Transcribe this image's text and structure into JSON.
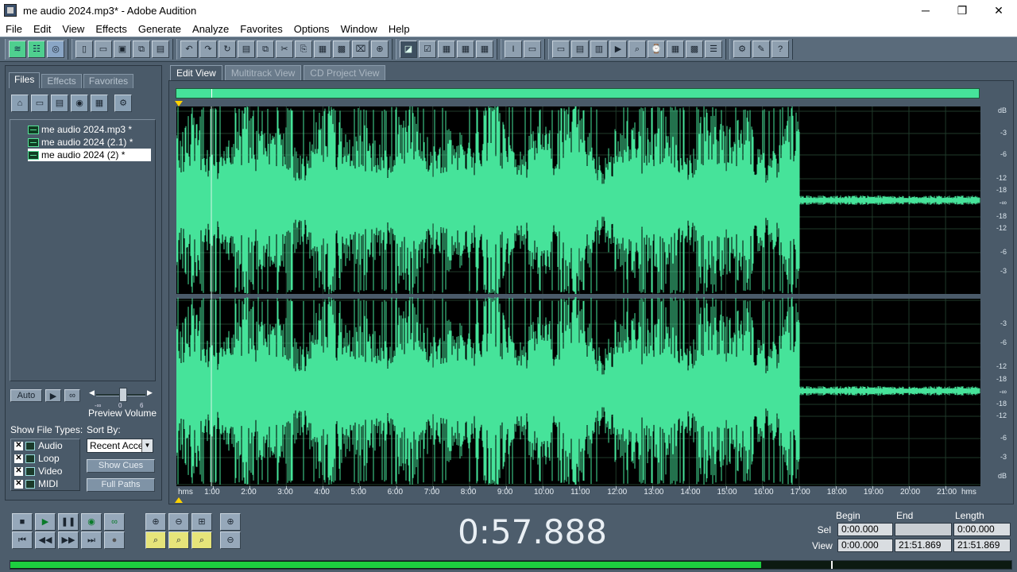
{
  "window": {
    "title": "me audio 2024.mp3* - Adobe Audition",
    "controls": {
      "minimize": "─",
      "maximize": "❐",
      "close": "✕"
    }
  },
  "menu": [
    "File",
    "Edit",
    "View",
    "Effects",
    "Generate",
    "Analyze",
    "Favorites",
    "Options",
    "Window",
    "Help"
  ],
  "left_panel": {
    "tabs": [
      "Files",
      "Effects",
      "Favorites"
    ],
    "active_tab": "Files",
    "files": [
      {
        "name": "me audio 2024.mp3 *",
        "selected": false
      },
      {
        "name": "me audio 2024 (2.1) *",
        "selected": false
      },
      {
        "name": "me audio 2024 (2) *",
        "selected": true
      }
    ],
    "preview": {
      "auto_label": "Auto",
      "play_icon": "▶",
      "loop_icon": "∞",
      "volume_label": "Preview Volume",
      "slider_min": "-∞",
      "slider_mid": "0",
      "slider_max": "6",
      "volume_level": 0.55
    },
    "file_types_label": "Show File Types:",
    "file_types": [
      {
        "label": "Audio",
        "checked": true
      },
      {
        "label": "Loop",
        "checked": true
      },
      {
        "label": "Video",
        "checked": true
      },
      {
        "label": "MIDI",
        "checked": true
      }
    ],
    "sort_label": "Sort By:",
    "sort_value": "Recent Acce",
    "show_cues_label": "Show Cues",
    "full_paths_label": "Full Paths"
  },
  "view_tabs": [
    "Edit View",
    "Multitrack View",
    "CD Project View"
  ],
  "active_view_tab": "Edit View",
  "waveform": {
    "db_labels_ch1": [
      "dB",
      "-3",
      "-6",
      "-12",
      "-18",
      "-∞",
      "-18",
      "-12",
      "-6",
      "-3"
    ],
    "db_labels_ch2": [
      "-3",
      "-6",
      "-12",
      "-18",
      "-∞",
      "-18",
      "-12",
      "-6",
      "-3",
      "dB"
    ],
    "time_unit": "hms",
    "time_labels": [
      "1:00",
      "2:00",
      "3:00",
      "4:00",
      "5:00",
      "6:00",
      "7:00",
      "8:00",
      "9:00",
      "10:00",
      "11:00",
      "12:00",
      "13:00",
      "14:00",
      "15:00",
      "16:00",
      "17:00",
      "18:00",
      "19:00",
      "20:00",
      "21:00"
    ],
    "color": "#46e39a"
  },
  "time_display": "0:57.888",
  "selection": {
    "headers": {
      "begin": "Begin",
      "end": "End",
      "length": "Length"
    },
    "sel_label": "Sel",
    "view_label": "View",
    "sel": {
      "begin": "0:00.000",
      "end": "",
      "length": "0:00.000"
    },
    "view": {
      "begin": "0:00.000",
      "end": "21:51.869",
      "length": "21:51.869"
    }
  },
  "level_meter": {
    "level": 0.75,
    "peak": 0.82,
    "color": "#1dcf3f"
  }
}
